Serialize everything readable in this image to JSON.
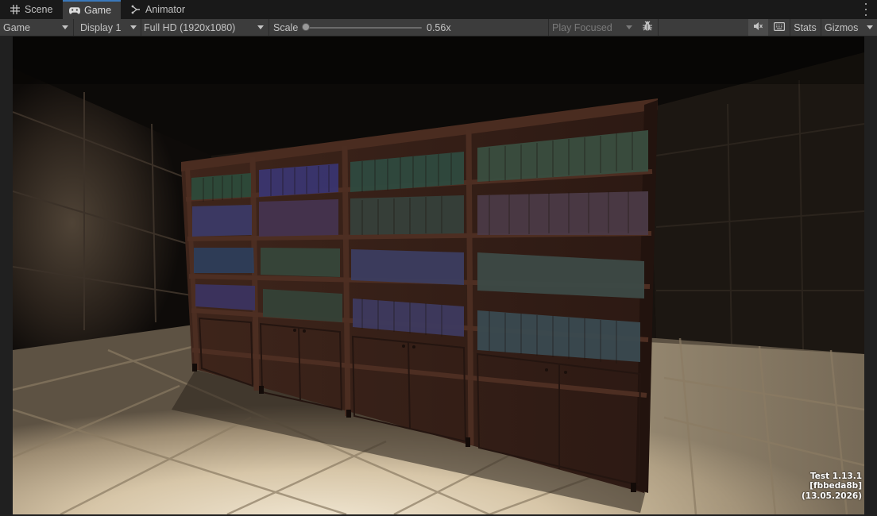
{
  "tabs": [
    {
      "label": "Scene",
      "icon": "grid-icon"
    },
    {
      "label": "Game",
      "icon": "gamepad-icon",
      "active": true
    },
    {
      "label": "Animator",
      "icon": "animator-icon"
    }
  ],
  "toolbar": {
    "view_select": "Game",
    "display_select": "Display 1",
    "resolution_select": "Full HD (1920x1080)",
    "scale_label": "Scale",
    "scale_value_text": "0.56x",
    "scale_level": 0.0,
    "play_mode_select": "Play Focused",
    "bug_icon": "bug-icon",
    "mute_icon": "mute-audio-icon",
    "keyboard_icon": "keyboard-icon",
    "stats_label": "Stats",
    "gizmos_label": "Gizmos"
  },
  "game_view": {
    "version_lines": [
      "Test 1.13.1",
      "[fbbeda8b]",
      "(13.05.2026)"
    ]
  },
  "colors": {
    "editor_bg": "#191919",
    "toolbar_bg": "#3c3c3c",
    "active_tab_accent": "#3a79bb",
    "wood": "#3a2218",
    "floor_lit": "#e8dcc4"
  }
}
